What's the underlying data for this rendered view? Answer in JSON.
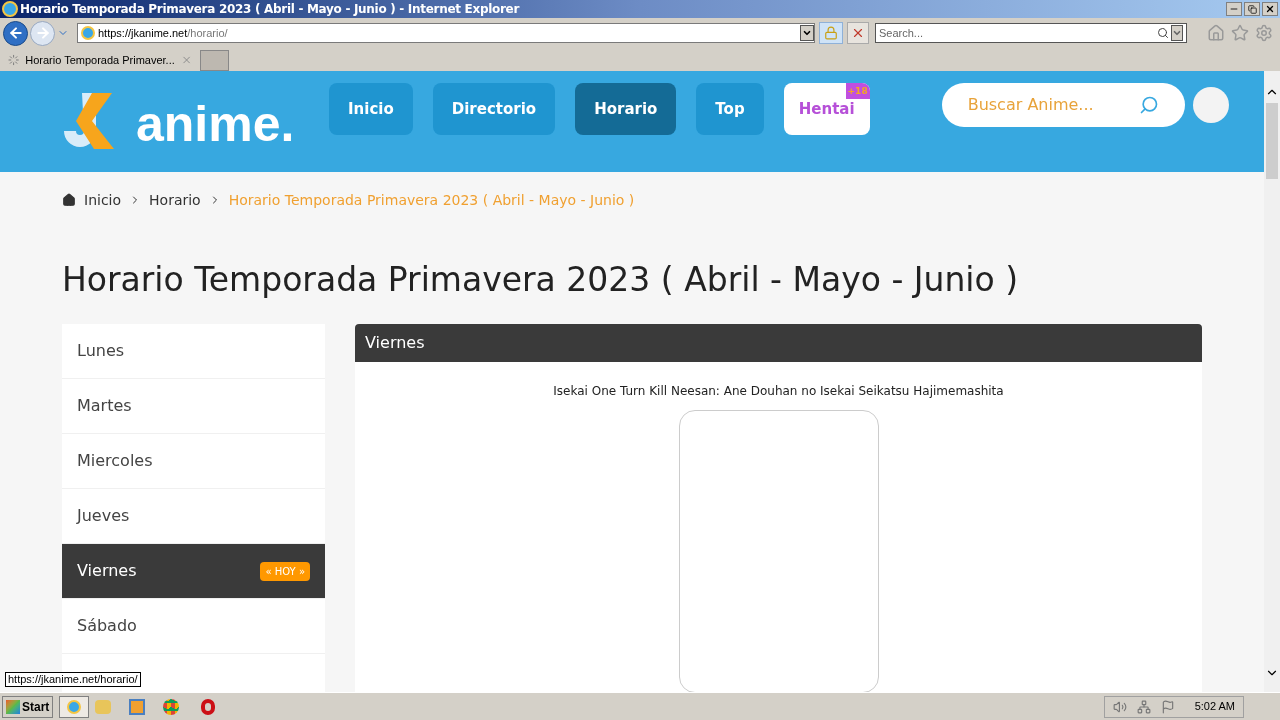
{
  "window": {
    "title": "Horario Temporada Primavera 2023 ( Abril - Mayo - Junio ) - Internet Explorer"
  },
  "address_bar": {
    "host": "https://jkanime.net",
    "path": "/horario/"
  },
  "search": {
    "placeholder": "Search..."
  },
  "tabs": [
    {
      "label": "Horario Temporada Primaver...",
      "selected": true
    }
  ],
  "site": {
    "logo": "anime.",
    "nav": [
      {
        "label": "Inicio",
        "selected": false,
        "kind": "link"
      },
      {
        "label": "Directorio",
        "selected": false,
        "kind": "link"
      },
      {
        "label": "Horario",
        "selected": true,
        "kind": "link"
      },
      {
        "label": "Top",
        "selected": false,
        "kind": "link"
      },
      {
        "label": "Hentai",
        "selected": false,
        "kind": "badge",
        "badge": "+18"
      }
    ],
    "search": {
      "placeholder": "Buscar Anime..."
    }
  },
  "breadcrumb": [
    {
      "label": "Inicio",
      "current": false
    },
    {
      "label": "Horario",
      "current": false
    },
    {
      "label": "Horario Temporada Primavera 2023 ( Abril - Mayo - Junio )",
      "current": true
    }
  ],
  "heading": "Horario Temporada Primavera 2023 ( Abril - Mayo - Junio )",
  "days": [
    {
      "label": "Lunes",
      "selected": false
    },
    {
      "label": "Martes",
      "selected": false
    },
    {
      "label": "Miercoles",
      "selected": false
    },
    {
      "label": "Jueves",
      "selected": false
    },
    {
      "label": "Viernes",
      "selected": true,
      "badge": "« HOY »"
    },
    {
      "label": "Sábado",
      "selected": false
    }
  ],
  "panel": {
    "title": "Viernes",
    "items": [
      {
        "title": "Isekai One Turn Kill Neesan: Ane Douhan no Isekai Seikatsu Hajimemashita"
      }
    ]
  },
  "status_tooltip": "https://jkanime.net/horario/",
  "taskbar": {
    "start": "Start",
    "clock": "5:02 AM"
  }
}
